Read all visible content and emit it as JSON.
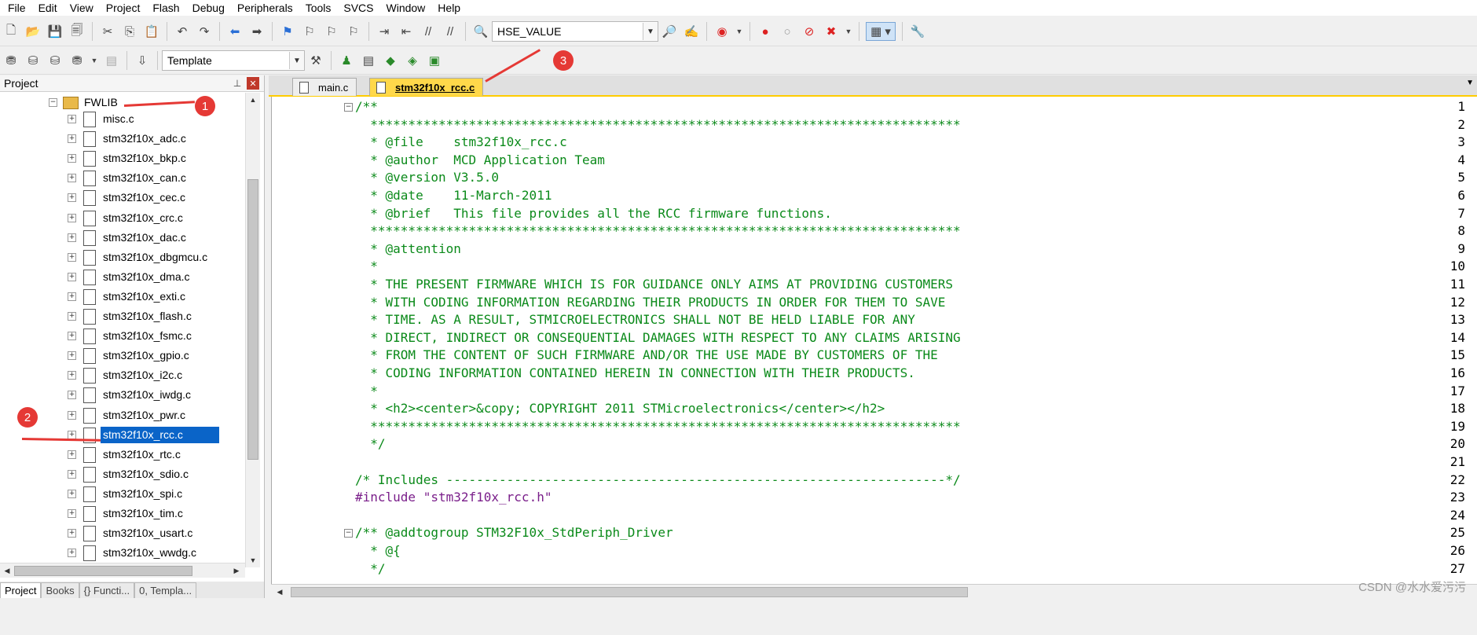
{
  "menu": [
    "File",
    "Edit",
    "View",
    "Project",
    "Flash",
    "Debug",
    "Peripherals",
    "Tools",
    "SVCS",
    "Window",
    "Help"
  ],
  "toolbar": {
    "find_combo_value": "HSE_VALUE",
    "target_combo_value": "Template"
  },
  "project_panel": {
    "title": "Project",
    "folder": "FWLIB",
    "files": [
      "misc.c",
      "stm32f10x_adc.c",
      "stm32f10x_bkp.c",
      "stm32f10x_can.c",
      "stm32f10x_cec.c",
      "stm32f10x_crc.c",
      "stm32f10x_dac.c",
      "stm32f10x_dbgmcu.c",
      "stm32f10x_dma.c",
      "stm32f10x_exti.c",
      "stm32f10x_flash.c",
      "stm32f10x_fsmc.c",
      "stm32f10x_gpio.c",
      "stm32f10x_i2c.c",
      "stm32f10x_iwdg.c",
      "stm32f10x_pwr.c",
      "stm32f10x_rcc.c",
      "stm32f10x_rtc.c",
      "stm32f10x_sdio.c",
      "stm32f10x_spi.c",
      "stm32f10x_tim.c",
      "stm32f10x_usart.c",
      "stm32f10x_wwdg.c"
    ],
    "selected_file": "stm32f10x_rcc.c",
    "bottom_tabs": [
      "Project",
      "Books",
      "{} Functi...",
      "0, Templa..."
    ]
  },
  "editor": {
    "tabs": [
      "main.c",
      "stm32f10x_rcc.c"
    ],
    "active_tab": "stm32f10x_rcc.c",
    "lines": [
      {
        "n": "1",
        "t": "/**",
        "c": "cm"
      },
      {
        "n": "2",
        "t": "  ******************************************************************************",
        "c": "cm"
      },
      {
        "n": "3",
        "t": "  * @file    stm32f10x_rcc.c",
        "c": "cm"
      },
      {
        "n": "4",
        "t": "  * @author  MCD Application Team",
        "c": "cm"
      },
      {
        "n": "5",
        "t": "  * @version V3.5.0",
        "c": "cm"
      },
      {
        "n": "6",
        "t": "  * @date    11-March-2011",
        "c": "cm"
      },
      {
        "n": "7",
        "t": "  * @brief   This file provides all the RCC firmware functions.",
        "c": "cm"
      },
      {
        "n": "8",
        "t": "  ******************************************************************************",
        "c": "cm"
      },
      {
        "n": "9",
        "t": "  * @attention",
        "c": "cm"
      },
      {
        "n": "10",
        "t": "  *",
        "c": "cm"
      },
      {
        "n": "11",
        "t": "  * THE PRESENT FIRMWARE WHICH IS FOR GUIDANCE ONLY AIMS AT PROVIDING CUSTOMERS",
        "c": "cm"
      },
      {
        "n": "12",
        "t": "  * WITH CODING INFORMATION REGARDING THEIR PRODUCTS IN ORDER FOR THEM TO SAVE",
        "c": "cm"
      },
      {
        "n": "13",
        "t": "  * TIME. AS A RESULT, STMICROELECTRONICS SHALL NOT BE HELD LIABLE FOR ANY",
        "c": "cm"
      },
      {
        "n": "14",
        "t": "  * DIRECT, INDIRECT OR CONSEQUENTIAL DAMAGES WITH RESPECT TO ANY CLAIMS ARISING",
        "c": "cm"
      },
      {
        "n": "15",
        "t": "  * FROM THE CONTENT OF SUCH FIRMWARE AND/OR THE USE MADE BY CUSTOMERS OF THE",
        "c": "cm"
      },
      {
        "n": "16",
        "t": "  * CODING INFORMATION CONTAINED HEREIN IN CONNECTION WITH THEIR PRODUCTS.",
        "c": "cm"
      },
      {
        "n": "17",
        "t": "  *",
        "c": "cm"
      },
      {
        "n": "18",
        "t": "  * <h2><center>&copy; COPYRIGHT 2011 STMicroelectronics</center></h2>",
        "c": "cm"
      },
      {
        "n": "19",
        "t": "  ******************************************************************************",
        "c": "cm"
      },
      {
        "n": "20",
        "t": "  */",
        "c": "cm"
      },
      {
        "n": "21",
        "t": "",
        "c": "cm"
      },
      {
        "n": "22",
        "t": "/* Includes ------------------------------------------------------------------*/",
        "c": "cm"
      },
      {
        "n": "23",
        "t": "#include ",
        "t2": "\"stm32f10x_rcc.h\"",
        "c": "pp"
      },
      {
        "n": "24",
        "t": "",
        "c": "cm"
      },
      {
        "n": "25",
        "t": "/** @addtogroup STM32F10x_StdPeriph_Driver",
        "c": "cm"
      },
      {
        "n": "26",
        "t": "  * @{",
        "c": "cm"
      },
      {
        "n": "27",
        "t": "  */",
        "c": "cm"
      }
    ]
  },
  "annotations": [
    "1",
    "2",
    "3"
  ],
  "watermark": "CSDN @水水爱污污",
  "colors": {
    "comment": "#0b8a1a",
    "preprocessor": "#7a1e8a",
    "selection": "#0a64c8",
    "active_tab": "#ffd84a",
    "marker": "#e53935"
  }
}
